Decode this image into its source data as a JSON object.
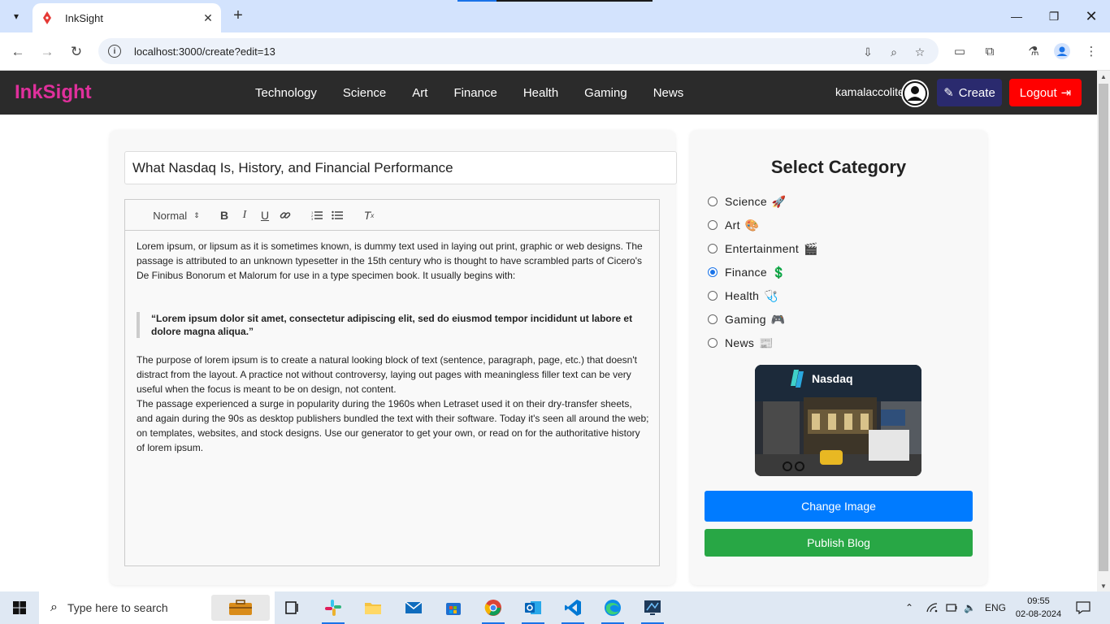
{
  "browser": {
    "tab_title": "InkSight",
    "url": "localhost:3000/create?edit=13",
    "new_tab": "+",
    "close": "✕"
  },
  "site": {
    "brand": "InkSight",
    "nav": [
      "Technology",
      "Science",
      "Art",
      "Finance",
      "Health",
      "Gaming",
      "News"
    ],
    "username": "kamalaccolite",
    "create_label": "Create",
    "logout_label": "Logout"
  },
  "editor": {
    "title_value": "What Nasdaq Is, History, and Financial Performance",
    "format_select": "Normal",
    "paragraph1": "Lorem ipsum, or lipsum as it is sometimes known, is dummy text used in laying out print, graphic or web designs. The passage is attributed to an unknown typesetter in the 15th century who is thought to have scrambled parts of Cicero's De Finibus Bonorum et Malorum for use in a type specimen book. It usually begins with:",
    "quote": "“Lorem ipsum dolor sit amet, consectetur adipiscing elit, sed do eiusmod tempor incididunt ut labore et dolore magna aliqua.”",
    "paragraph2": "The purpose of lorem ipsum is to create a natural looking block of text (sentence, paragraph, page, etc.) that doesn't distract from the layout. A practice not without controversy, laying out pages with meaningless filler text can be very useful when the focus is meant to be on design, not content.",
    "paragraph3": "The passage experienced a surge in popularity during the 1960s when Letraset used it on their dry-transfer sheets, and again during the 90s as desktop publishers bundled the text with their software. Today it's seen all around the web; on templates, websites, and stock designs. Use our generator to get your own, or read on for the authoritative history of lorem ipsum."
  },
  "sidebar": {
    "heading": "Select Category",
    "categories": [
      {
        "label": "Science",
        "emoji": "🚀",
        "selected": false
      },
      {
        "label": "Art",
        "emoji": "🎨",
        "selected": false
      },
      {
        "label": "Entertainment",
        "emoji": "🎬",
        "selected": false
      },
      {
        "label": "Finance",
        "emoji": "💲",
        "selected": true
      },
      {
        "label": "Health",
        "emoji": "🩺",
        "selected": false
      },
      {
        "label": "Gaming",
        "emoji": "🎮",
        "selected": false
      },
      {
        "label": "News",
        "emoji": "📰",
        "selected": false
      }
    ],
    "image_sign": "Nasdaq",
    "change_image_label": "Change Image",
    "publish_label": "Publish Blog"
  },
  "taskbar": {
    "search_placeholder": "Type here to search",
    "language": "ENG",
    "time": "09:55",
    "date": "02-08-2024"
  },
  "colors": {
    "brand": "#e0309c",
    "navbar": "#2b2b2b",
    "create": "#2a2a6e",
    "logout": "#ff0000",
    "change_image": "#007bff",
    "publish": "#28a745"
  }
}
